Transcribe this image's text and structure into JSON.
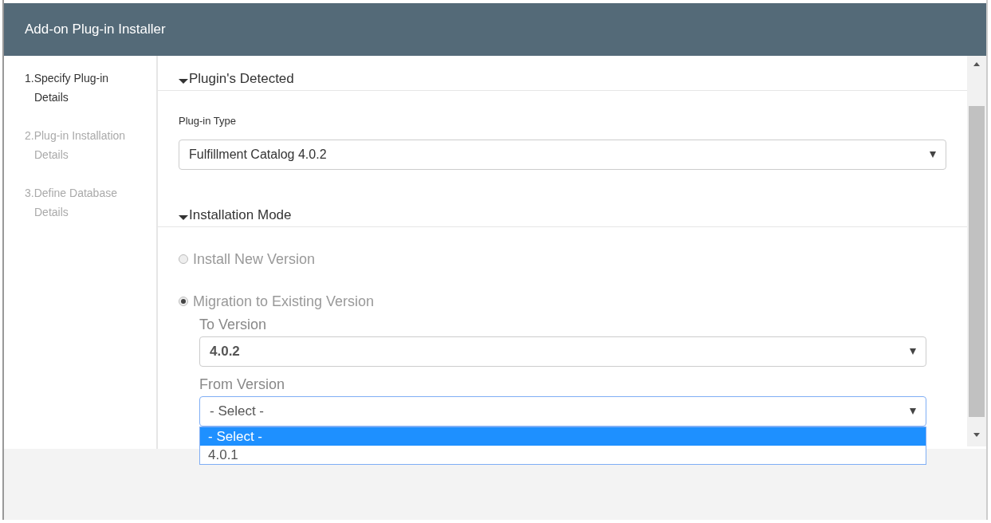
{
  "window": {
    "title": "Add-on Plug-in Installer"
  },
  "steps": [
    {
      "label": "1.Specify Plug-in",
      "sublabel": "Details",
      "selected": true
    },
    {
      "label": "2.Plug-in Installation",
      "sublabel": "Details",
      "selected": false
    },
    {
      "label": "3.Define Database",
      "sublabel": "Details",
      "selected": false
    }
  ],
  "plugins_section": {
    "title": "Plugin's Detected",
    "expanded": true,
    "plugin_type": {
      "label": "Plug-in Type",
      "value": "Fulfillment Catalog 4.0.2"
    }
  },
  "installation_section": {
    "title": "Installation Mode",
    "expanded": true,
    "modes": [
      {
        "label": "Install New Version",
        "selected": false
      },
      {
        "label": "Migration to Existing Version",
        "selected": true
      }
    ],
    "to_version": {
      "label": "To Version",
      "value": "4.0.2"
    },
    "from_version": {
      "label": "From Version",
      "value": "- Select -",
      "open": true,
      "options": [
        {
          "label": "- Select -",
          "selected": true
        },
        {
          "label": "4.0.1",
          "selected": false
        }
      ]
    }
  }
}
